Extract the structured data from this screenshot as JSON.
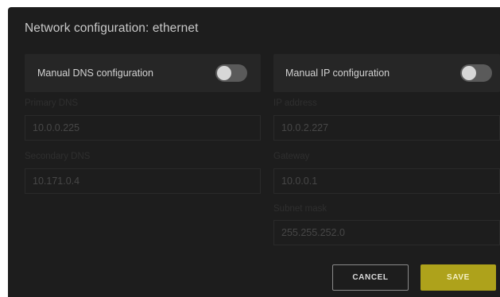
{
  "dialog": {
    "title": "Network configuration: ethernet"
  },
  "dns_toggle": {
    "label": "Manual DNS configuration",
    "enabled": false
  },
  "ip_toggle": {
    "label": "Manual IP configuration",
    "enabled": false
  },
  "fields": {
    "primary_dns": {
      "label": "Primary DNS",
      "value": "10.0.0.225"
    },
    "secondary_dns": {
      "label": "Secondary DNS",
      "value": "10.171.0.4"
    },
    "ip_address": {
      "label": "IP address",
      "value": "10.0.2.227"
    },
    "gateway": {
      "label": "Gateway",
      "value": "10.0.0.1"
    },
    "subnet_mask": {
      "label": "Subnet mask",
      "value": "255.255.252.0"
    }
  },
  "buttons": {
    "cancel": "CANCEL",
    "save": "SAVE"
  },
  "colors": {
    "dialog_background": "#1d1d1d",
    "save_accent": "#aea21b"
  }
}
